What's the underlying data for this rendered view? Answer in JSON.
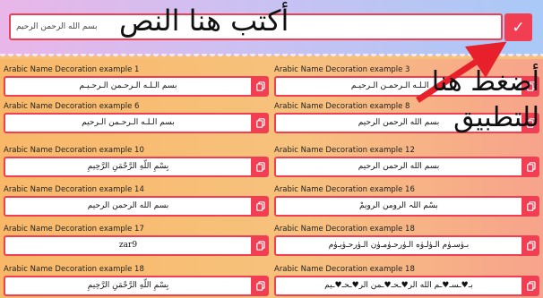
{
  "header": {
    "input_value": "بسم الله الرحمن الرحيم",
    "apply_glyph": "✓",
    "overlay_title": "أكتب هنا النص",
    "overlay_hint": "أضغط هنا للتطبيق"
  },
  "cells": [
    {
      "label": "Arabic Name Decoration example 1",
      "text": "بسم الـلـه الـرحـمن الـرحـيـم"
    },
    {
      "label": "Arabic Name Decoration example 3",
      "text": "بسم الـلـه الـرحمـن الـرحيـم"
    },
    {
      "label": "Arabic Name Decoration example 6",
      "text": "بسم الـلـه الـرحـمن الـرحيم"
    },
    {
      "label": "Arabic Name Decoration example 8",
      "text": "بسم الله الرحمن الرحيم"
    },
    {
      "label": "Arabic Name Decoration example 10",
      "text": "بِسْمِ اللّهِ الرَّحْمَنِ الرَّحِيمِ"
    },
    {
      "label": "Arabic Name Decoration example 12",
      "text": "بسم الله الرحمن الرحيم"
    },
    {
      "label": "Arabic Name Decoration example 14",
      "text": "بسم الله الرحمن الرحيم"
    },
    {
      "label": "Arabic Name Decoration example 16",
      "text": "بسْم اللہ الرومن الرویمْ"
    },
    {
      "label": "Arabic Name Decoration example 17",
      "text": "zar9"
    },
    {
      "label": "Arabic Name Decoration example 18",
      "text": "بـﯛسـﯛم الـﯛلـﯛه الـﯛرحـﯛمـﯛن الـﯛرحـﯛيـﯛم"
    },
    {
      "label": "Arabic Name Decoration example 18",
      "text": "بِسْمِ اللّهِ الرَّحْمَنِ الرَّحِيمِ"
    },
    {
      "label": "Arabic Name Decoration example 18",
      "text": "بـ♥ـسـ♥ـم الله الر♥ـحـ♥ـمن الر♥ـحـ♥ـيم"
    }
  ],
  "colors": {
    "accent": "#f23e52"
  },
  "icons": {
    "copy": "copy-icon",
    "apply": "check-icon"
  }
}
